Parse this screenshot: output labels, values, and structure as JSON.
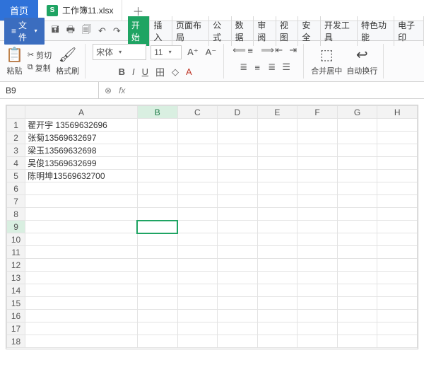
{
  "tabbar": {
    "home": "首页",
    "file_icon": "S",
    "filename": "工作簿11.xlsx",
    "add": "＋"
  },
  "menubar": {
    "file": "文件",
    "qat": {
      "save": "🖬",
      "print": "🖶",
      "preview": "🗐",
      "undo": "↶",
      "redo": "↷"
    },
    "tabs": [
      "开始",
      "插入",
      "页面布局",
      "公式",
      "数据",
      "审阅",
      "视图",
      "安全",
      "开发工具",
      "特色功能",
      "电子印"
    ]
  },
  "ribbon": {
    "paste": "粘贴",
    "cut": "剪切",
    "copy": "复制",
    "formatpainter": "格式刷",
    "font": "宋体",
    "size": "11",
    "merge": "合并居中",
    "wrap": "自动换行"
  },
  "namebox": {
    "ref": "B9",
    "fx": "fx"
  },
  "columns": [
    "A",
    "B",
    "C",
    "D",
    "E",
    "F",
    "G",
    "H"
  ],
  "chart_data": {
    "type": "table",
    "title": "",
    "columns": [
      "A"
    ],
    "rows": [
      [
        "翟开宇 13569632696"
      ],
      [
        "张菊13569632697"
      ],
      [
        "梁玉13569632698"
      ],
      [
        "吴俊13569632699"
      ],
      [
        "陈明坤13569632700"
      ]
    ]
  },
  "selected": {
    "row": 9,
    "col": "B"
  }
}
